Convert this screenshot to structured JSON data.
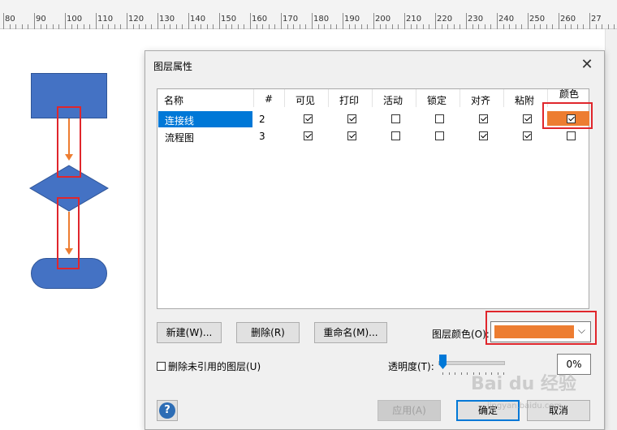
{
  "ruler": {
    "labels": [
      "80",
      "90",
      "100",
      "110",
      "120",
      "130",
      "140",
      "150",
      "160",
      "170",
      "180",
      "190",
      "200",
      "210",
      "220",
      "230",
      "240",
      "250",
      "260",
      "27"
    ]
  },
  "dialog": {
    "title": "图层属性",
    "columns": [
      "名称",
      "#",
      "可见",
      "打印",
      "活动",
      "锁定",
      "对齐",
      "粘附",
      "颜色"
    ],
    "rows": [
      {
        "name": "连接线",
        "num": "2",
        "visible": true,
        "print": true,
        "active": false,
        "lock": false,
        "snap": true,
        "glue": true,
        "color": true
      },
      {
        "name": "流程图",
        "num": "3",
        "visible": true,
        "print": true,
        "active": false,
        "lock": false,
        "snap": true,
        "glue": true,
        "color": false
      }
    ],
    "buttons": {
      "new": "新建(W)...",
      "delete": "删除(R)",
      "rename": "重命名(M)...",
      "apply": "应用(A)",
      "ok": "确定",
      "cancel": "取消"
    },
    "layer_color_label": "图层颜色(O):",
    "layer_color": "#ed7d31",
    "remove_unused_label": "删除未引用的图层(U)",
    "transparency_label": "透明度(T):",
    "transparency_value": "0%",
    "help_glyph": "?"
  },
  "watermark": {
    "main": "Bai du 经验",
    "sub": "jingyan.baidu.com"
  },
  "colors": {
    "shape_fill": "#4472c4",
    "connector": "#ed7d31",
    "highlight": "#e0262c",
    "selection": "#0078d7"
  }
}
